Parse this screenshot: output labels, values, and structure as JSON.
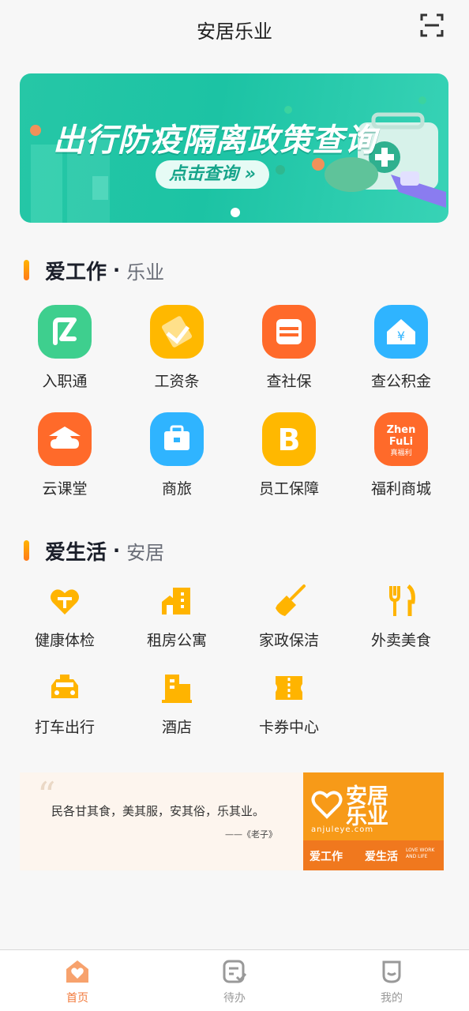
{
  "header": {
    "title": "安居乐业",
    "scan_icon": "scan-icon"
  },
  "banner": {
    "title": "出行防疫隔离政策查询",
    "button_label": "点击查询 »",
    "colors": {
      "bg": "#26c7a6",
      "button_text": "#16a48a"
    }
  },
  "work_section": {
    "title": "爱工作",
    "subtitle": "乐业",
    "items": [
      {
        "label": "入职通",
        "icon": "onboarding-icon",
        "color": "#3ecf8e"
      },
      {
        "label": "工资条",
        "icon": "payslip-icon",
        "color": "#ffb800"
      },
      {
        "label": "查社保",
        "icon": "social-security-icon",
        "color": "#ff6a2a"
      },
      {
        "label": "查公积金",
        "icon": "housing-fund-icon",
        "color": "#2fb4ff"
      },
      {
        "label": "云课堂",
        "icon": "cloud-class-icon",
        "color": "#ff6a2a"
      },
      {
        "label": "商旅",
        "icon": "business-travel-icon",
        "color": "#2fb4ff"
      },
      {
        "label": "员工保障",
        "icon": "employee-protection-icon",
        "color": "#ffb800"
      },
      {
        "label": "福利商城",
        "icon": "welfare-mall-icon",
        "color": "#ff6a2a",
        "badge_text": [
          "Zhen",
          "FuLi",
          "真福利"
        ]
      }
    ]
  },
  "life_section": {
    "title": "爱生活",
    "subtitle": "安居",
    "items": [
      {
        "label": "健康体检",
        "icon": "health-check-icon"
      },
      {
        "label": "租房公寓",
        "icon": "apartment-icon"
      },
      {
        "label": "家政保洁",
        "icon": "cleaning-icon"
      },
      {
        "label": "外卖美食",
        "icon": "food-delivery-icon"
      },
      {
        "label": "打车出行",
        "icon": "taxi-icon"
      },
      {
        "label": "酒店",
        "icon": "hotel-icon"
      },
      {
        "label": "卡券中心",
        "icon": "coupon-icon"
      }
    ],
    "icon_color": "#ffb400"
  },
  "quote_card": {
    "quote": "民各甘其食，美其服，安其俗，乐其业。",
    "source": "——《老子》",
    "logo_name": "安居乐业",
    "logo_url": "anjuleye.com",
    "slogan_work": "爱工作",
    "slogan_life": "爱生活",
    "slogan_en": "LOVE WORK AND LIFE"
  },
  "tabbar": {
    "tabs": [
      {
        "label": "首页",
        "icon": "home-icon",
        "active": true
      },
      {
        "label": "待办",
        "icon": "todo-icon",
        "active": false
      },
      {
        "label": "我的",
        "icon": "profile-icon",
        "active": false
      }
    ],
    "active_color": "#f27a3c",
    "inactive_color": "#999999"
  }
}
